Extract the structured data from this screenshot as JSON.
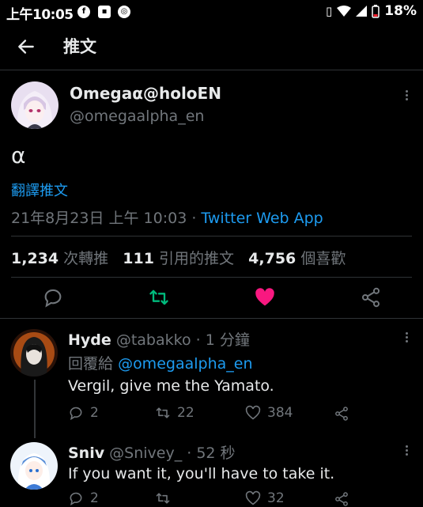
{
  "status": {
    "time": "上午10:05",
    "battery": "18%"
  },
  "header": {
    "title": "推文"
  },
  "tweet": {
    "display_name": "Omegaα@holoEN",
    "handle": "@omegaalpha_en",
    "text": "α",
    "translate": "翻譯推文",
    "datetime": "21年8月23日 上午 10:03",
    "separator": "·",
    "source": "Twitter Web App",
    "retweets_count": "1,234",
    "retweets_label": "次轉推",
    "quotes_count": "111",
    "quotes_label": "引用的推文",
    "likes_count": "4,756",
    "likes_label": "個喜歡"
  },
  "replies": [
    {
      "display_name": "Hyde",
      "handle": "@tabakko",
      "time": "· 1 分鐘",
      "replying_prefix": "回覆給",
      "replying_to": "@omegaalpha_en",
      "text": "Vergil, give me the Yamato.",
      "reply_count": "2",
      "retweet_count": "22",
      "like_count": "384"
    },
    {
      "display_name": "Sniv",
      "handle": "@Snivey_",
      "time": "· 52 秒",
      "text": "If you want it, you'll have to take it.",
      "reply_count": "2",
      "like_count": "32"
    }
  ],
  "colors": {
    "accent": "#1d9bf0",
    "retweet_green": "#00ba7c",
    "like_pink": "#f91880",
    "muted": "#71767b"
  }
}
